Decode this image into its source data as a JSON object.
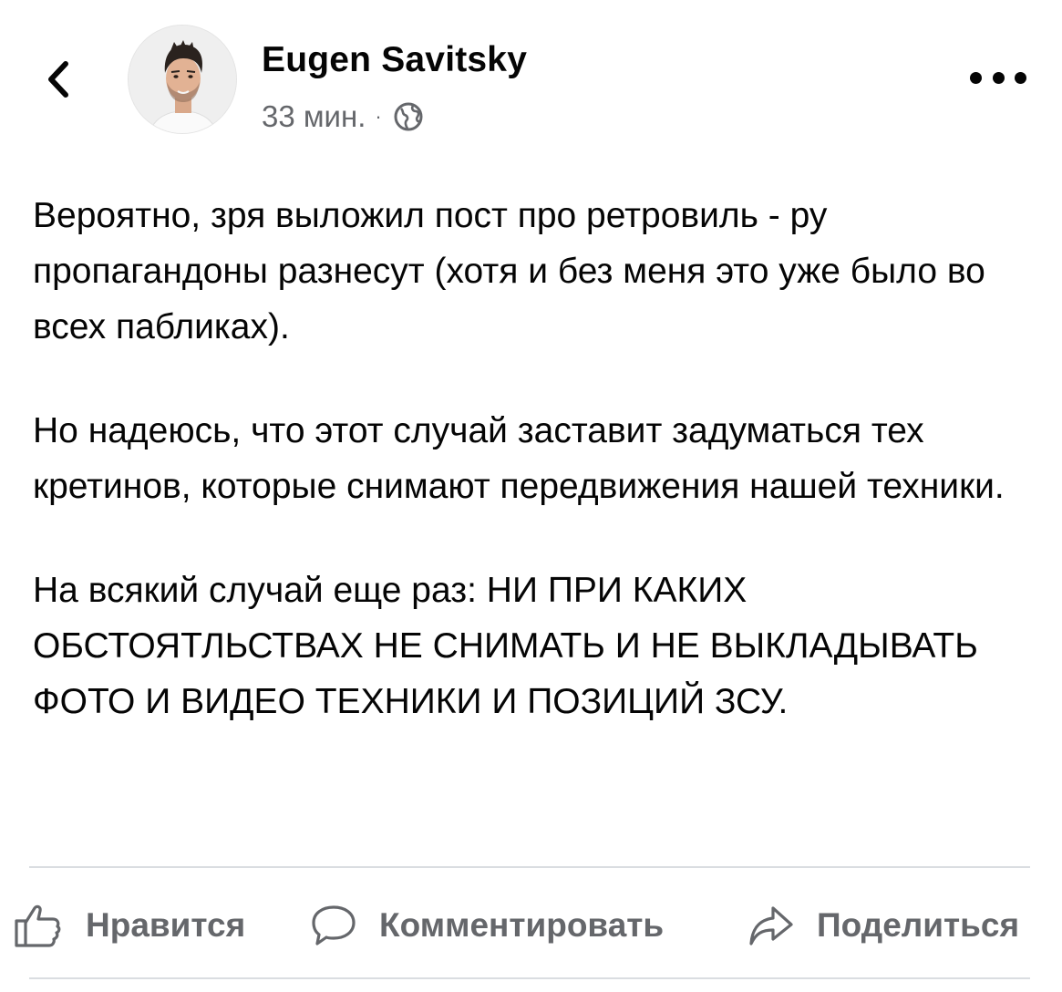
{
  "post": {
    "author_name": "Eugen Savitsky",
    "timestamp": "33 мин.",
    "separator": "·",
    "audience_icon": "globe-icon",
    "paragraphs": [
      "Вероятно, зря выложил пост про ретровиль - ру пропагандоны разнесут (хотя и без меня это уже было во всех пабликах).",
      "Но надеюсь, что этот случай заставит задуматься тех кретинов, которые снимают передвижения нашей техники.",
      "На всякий случай еще раз: НИ ПРИ КАКИХ ОБСТОЯТЛЬСТВАХ НЕ СНИМАТЬ И НЕ ВЫКЛАДЫВАТЬ ФОТО И ВИДЕО ТЕХНИКИ И ПОЗИЦИЙ ЗСУ."
    ]
  },
  "header": {
    "back_icon": "chevron-left-icon",
    "more_icon": "more-horizontal-icon"
  },
  "actions": {
    "like_label": "Нравится",
    "comment_label": "Комментировать",
    "share_label": "Поделиться"
  },
  "colors": {
    "text_primary": "#050505",
    "text_secondary": "#65676b",
    "divider": "#dadde1"
  }
}
